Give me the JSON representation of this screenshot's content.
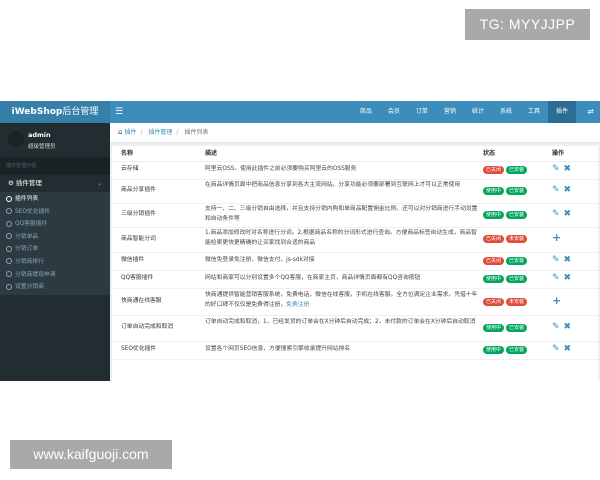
{
  "watermark_top": "TG: MYYJJPP",
  "watermark_bottom": "www.kaifguoji.com",
  "brand": {
    "bold": "iWebShop",
    "light": "后台管理"
  },
  "topbar": {
    "menu_icon": "bars-icon",
    "nav": [
      "商品",
      "会员",
      "订单",
      "营销",
      "统计",
      "系统",
      "工具",
      "插件"
    ],
    "active_nav": "插件",
    "share_icon": "share-icon"
  },
  "user": {
    "name": "admin",
    "role": "超级管理员"
  },
  "sidebar": {
    "section_label": "插件管理分组",
    "group_label": "插件管理",
    "items": [
      "插件列表",
      "SEO优化插件",
      "QQ客服插件",
      "分销单品",
      "分销订单",
      "分销商排行",
      "分销商提现申请",
      "设置分销商"
    ]
  },
  "breadcrumb": {
    "home": "插件",
    "parent": "插件管理",
    "current": "插件列表"
  },
  "table": {
    "headers": {
      "name": "名称",
      "desc": "描述",
      "status": "状态",
      "action": "操作"
    },
    "rows": [
      {
        "name": "云存储",
        "desc": "阿里云OSS。使用此插件之前必须要购买阿里云的OSS服务",
        "tags": [
          {
            "label": "已关闭",
            "type": "red"
          },
          {
            "label": "已安装",
            "type": "green"
          }
        ],
        "actions": [
          "edit",
          "delete"
        ]
      },
      {
        "name": "商品分享插件",
        "desc": "在商品详情页面中把商品信息分享到各大主流网站。分享功能必须要部署到互联网上才可以正常使用",
        "tags": [
          {
            "label": "使用中",
            "type": "green"
          },
          {
            "label": "已安装",
            "type": "green"
          }
        ],
        "actions": [
          "edit",
          "delete"
        ]
      },
      {
        "name": "三级分销插件",
        "desc": "支持一、二、三级分销自由选择，并且支持分销内购和单商品配置佣金比例。还可以对分销商进行手动设置和自动条件等",
        "tags": [
          {
            "label": "使用中",
            "type": "green"
          },
          {
            "label": "已安装",
            "type": "green"
          }
        ],
        "actions": [
          "edit",
          "delete"
        ]
      },
      {
        "name": "商品智能分词",
        "desc": "1,商品添加修改时对名称进行分词。2,根据商品名称的分词形式进行查询。方便商品标签自动生成，商品智能检索更快更精确的让买家找到合适的商品",
        "tags": [
          {
            "label": "已关闭",
            "type": "red"
          },
          {
            "label": "未安装",
            "type": "red"
          }
        ],
        "actions": [
          "add"
        ]
      },
      {
        "name": "微信插件",
        "desc": "微信免登录免注册，微信支付，js-sdk对接",
        "tags": [
          {
            "label": "已关闭",
            "type": "red"
          },
          {
            "label": "已安装",
            "type": "green"
          }
        ],
        "actions": [
          "edit",
          "delete"
        ]
      },
      {
        "name": "QQ客服插件",
        "desc": "网站和商家可以分别设置多个QQ客服，在商家主页，商品详情页面都有QQ咨询按钮",
        "tags": [
          {
            "label": "使用中",
            "type": "green"
          },
          {
            "label": "已安装",
            "type": "green"
          }
        ],
        "actions": [
          "edit",
          "delete"
        ]
      },
      {
        "name": "快商通在线客服",
        "desc": "快商通提供智能营销客服系统，免费电话，微信在线客服，手机在线客服。全方位满足企业需求。凭借十年的好口碑不仅仅是免费得注册，",
        "link": "免费注册",
        "tags": [
          {
            "label": "已关闭",
            "type": "red"
          },
          {
            "label": "未安装",
            "type": "red"
          }
        ],
        "actions": [
          "add"
        ]
      },
      {
        "name": "订单自动完成和取消",
        "desc": "订单自动完成和取消，1，已经发货的订单会在X分钟后自动完成；2，未付款的订单会在X分钟后自动取消",
        "tags": [
          {
            "label": "使用中",
            "type": "green"
          },
          {
            "label": "已安装",
            "type": "green"
          }
        ],
        "actions": [
          "edit",
          "delete"
        ]
      },
      {
        "name": "SEO优化插件",
        "desc": "设置各个网页SEO信息，方便搜索引擎收录提升网站排名",
        "tags": [
          {
            "label": "使用中",
            "type": "green"
          },
          {
            "label": "已安装",
            "type": "green"
          }
        ],
        "actions": [
          "edit",
          "delete"
        ]
      }
    ]
  },
  "colors": {
    "topbar": "#3c8dbc",
    "sidebar": "#222d32",
    "tag_red": "#dd4b39",
    "tag_green": "#00a65a"
  }
}
